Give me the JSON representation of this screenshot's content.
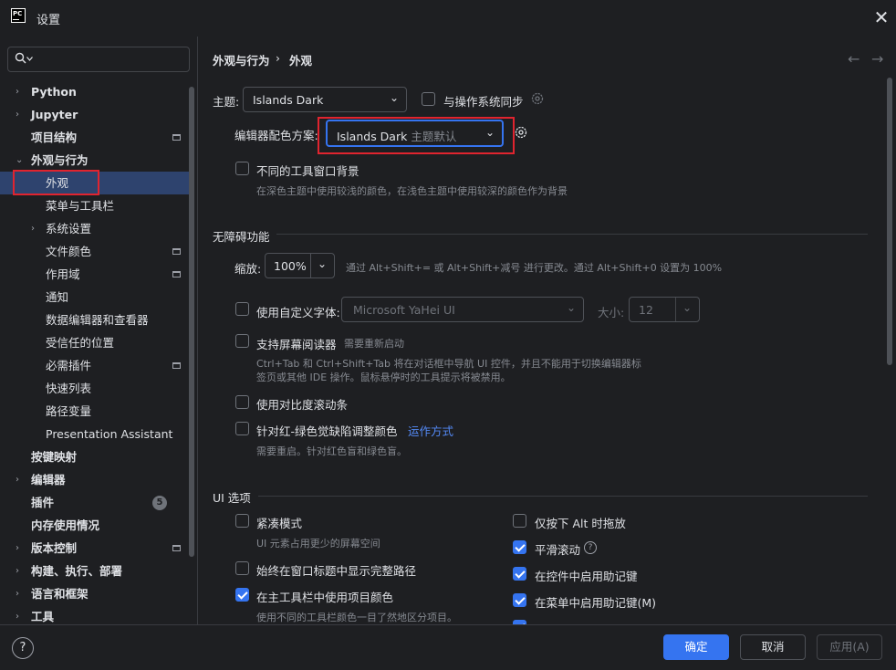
{
  "window": {
    "title": "设置",
    "logo_text": "PC"
  },
  "search": {
    "placeholder": ""
  },
  "sidebar": {
    "items": [
      {
        "label": "Python"
      },
      {
        "label": "Jupyter"
      },
      {
        "label": "项目结构"
      },
      {
        "label": "外观与行为"
      },
      {
        "label": "外观"
      },
      {
        "label": "菜单与工具栏"
      },
      {
        "label": "系统设置"
      },
      {
        "label": "文件颜色"
      },
      {
        "label": "作用域"
      },
      {
        "label": "通知"
      },
      {
        "label": "数据编辑器和查看器"
      },
      {
        "label": "受信任的位置"
      },
      {
        "label": "必需插件"
      },
      {
        "label": "快速列表"
      },
      {
        "label": "路径变量"
      },
      {
        "label": "Presentation Assistant"
      },
      {
        "label": "按键映射"
      },
      {
        "label": "编辑器"
      },
      {
        "label": "插件",
        "badge": "5"
      },
      {
        "label": "内存使用情况"
      },
      {
        "label": "版本控制"
      },
      {
        "label": "构建、执行、部署"
      },
      {
        "label": "语言和框架"
      },
      {
        "label": "工具"
      }
    ]
  },
  "breadcrumb": {
    "parent": "外观与行为",
    "separator": "›",
    "current": "外观"
  },
  "nav": {
    "back": "←",
    "forward": "→"
  },
  "theme": {
    "label": "主题:",
    "value": "Islands Dark",
    "sync_label": "与操作系统同步",
    "sync_checked": false
  },
  "editor_scheme": {
    "label": "编辑器配色方案:",
    "value": "Islands Dark",
    "value_suffix": "主题默认"
  },
  "tool_window_bg": {
    "label": "不同的工具窗口背景",
    "hint": "在深色主题中使用较浅的颜色，在浅色主题中使用较深的颜色作为背景",
    "checked": false
  },
  "accessibility": {
    "section_title": "无障碍功能",
    "zoom_label": "缩放:",
    "zoom_value": "100%",
    "zoom_hint": "通过 Alt+Shift+= 或 Alt+Shift+减号 进行更改。通过 Alt+Shift+0 设置为 100%",
    "custom_font_label": "使用自定义字体:",
    "custom_font_checked": false,
    "font_value": "Microsoft YaHei UI",
    "size_label": "大小:",
    "size_value": "12",
    "screen_reader_label": "支持屏幕阅读器",
    "screen_reader_note": "需要重新启动",
    "screen_reader_checked": false,
    "screen_reader_hint_1": "Ctrl+Tab 和 Ctrl+Shift+Tab 将在对话框中导航 UI 控件，并且不能用于切换编辑器标",
    "screen_reader_hint_2": "签页或其他 IDE 操作。鼠标悬停时的工具提示将被禁用。",
    "contrast_scroll_label": "使用对比度滚动条",
    "contrast_scroll_checked": false,
    "color_blind_label": "针对红-绿色觉缺陷调整颜色",
    "color_blind_link": "运作方式",
    "color_blind_checked": false,
    "color_blind_hint": "需要重启。针对红色盲和绿色盲。"
  },
  "ui_options": {
    "section_title": "UI 选项",
    "compact_label": "紧凑模式",
    "compact_hint": "UI 元素占用更少的屏幕空间",
    "compact_checked": false,
    "full_path_label": "始终在窗口标题中显示完整路径",
    "full_path_checked": false,
    "project_color_label": "在主工具栏中使用项目颜色",
    "project_color_hint": "使用不同的工具栏颜色一目了然地区分项目。",
    "project_color_checked": true,
    "alt_drag_label": "仅按下 Alt 时拖放",
    "alt_drag_checked": false,
    "smooth_scroll_label": "平滑滚动",
    "smooth_scroll_checked": true,
    "mnemonics_controls_label": "在控件中启用助记键",
    "mnemonics_controls_checked": true,
    "mnemonics_menu_label": "在菜单中启用助记键(M)",
    "mnemonics_menu_checked": true
  },
  "footer": {
    "help": "?",
    "ok": "确定",
    "cancel": "取消",
    "apply": "应用(A)"
  },
  "colors": {
    "background": "#1e1f22",
    "accent": "#3574f0",
    "selection": "#2e436e",
    "highlight_red": "#e0242f",
    "link": "#548af7"
  }
}
